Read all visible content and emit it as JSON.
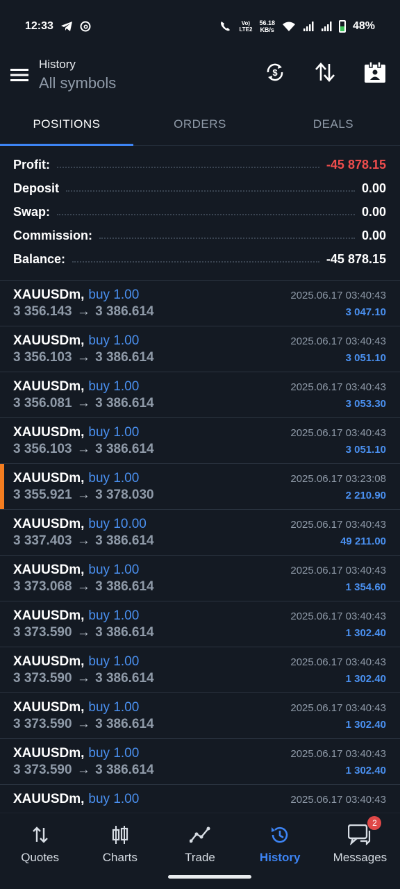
{
  "status_bar": {
    "time": "12:33",
    "net_speed_top": "56.18",
    "net_speed_bottom": "KB/s",
    "volte_top": "Vo)",
    "volte_bottom": "LTE2",
    "battery": "48%",
    "icons": [
      "telegram-icon",
      "threads-icon",
      "wifi-call-icon",
      "wifi-icon",
      "signal-icon",
      "battery-icon"
    ]
  },
  "header": {
    "small_title": "History",
    "big_title": "All symbols",
    "actions": [
      "currency-switch-icon",
      "sort-icon",
      "calendar-icon"
    ]
  },
  "tabs": [
    {
      "label": "POSITIONS",
      "active": true
    },
    {
      "label": "ORDERS",
      "active": false
    },
    {
      "label": "DEALS",
      "active": false
    }
  ],
  "summary": {
    "profit_label": "Profit:",
    "profit_value": "-45 878.15",
    "deposit_label": "Deposit",
    "deposit_value": "0.00",
    "swap_label": "Swap:",
    "swap_value": "0.00",
    "commission_label": "Commission:",
    "commission_value": "0.00",
    "balance_label": "Balance:",
    "balance_value": "-45 878.15"
  },
  "positions": [
    {
      "symbol": "XAUUSDm,",
      "side": "buy 1.00",
      "open": "3 356.143",
      "close": "3 386.614",
      "time": "2025.06.17 03:40:43",
      "profit": "3 047.10"
    },
    {
      "symbol": "XAUUSDm,",
      "side": "buy 1.00",
      "open": "3 356.103",
      "close": "3 386.614",
      "time": "2025.06.17 03:40:43",
      "profit": "3 051.10"
    },
    {
      "symbol": "XAUUSDm,",
      "side": "buy 1.00",
      "open": "3 356.081",
      "close": "3 386.614",
      "time": "2025.06.17 03:40:43",
      "profit": "3 053.30"
    },
    {
      "symbol": "XAUUSDm,",
      "side": "buy 1.00",
      "open": "3 356.103",
      "close": "3 386.614",
      "time": "2025.06.17 03:40:43",
      "profit": "3 051.10"
    },
    {
      "symbol": "XAUUSDm,",
      "side": "buy 1.00",
      "open": "3 355.921",
      "close": "3 378.030",
      "time": "2025.06.17 03:23:08",
      "profit": "2 210.90"
    },
    {
      "symbol": "XAUUSDm,",
      "side": "buy 10.00",
      "open": "3 337.403",
      "close": "3 386.614",
      "time": "2025.06.17 03:40:43",
      "profit": "49 211.00"
    },
    {
      "symbol": "XAUUSDm,",
      "side": "buy 1.00",
      "open": "3 373.068",
      "close": "3 386.614",
      "time": "2025.06.17 03:40:43",
      "profit": "1 354.60"
    },
    {
      "symbol": "XAUUSDm,",
      "side": "buy 1.00",
      "open": "3 373.590",
      "close": "3 386.614",
      "time": "2025.06.17 03:40:43",
      "profit": "1 302.40"
    },
    {
      "symbol": "XAUUSDm,",
      "side": "buy 1.00",
      "open": "3 373.590",
      "close": "3 386.614",
      "time": "2025.06.17 03:40:43",
      "profit": "1 302.40"
    },
    {
      "symbol": "XAUUSDm,",
      "side": "buy 1.00",
      "open": "3 373.590",
      "close": "3 386.614",
      "time": "2025.06.17 03:40:43",
      "profit": "1 302.40"
    },
    {
      "symbol": "XAUUSDm,",
      "side": "buy 1.00",
      "open": "3 373.590",
      "close": "3 386.614",
      "time": "2025.06.17 03:40:43",
      "profit": "1 302.40"
    },
    {
      "symbol": "XAUUSDm,",
      "side": "buy 1.00",
      "open": "",
      "close": "",
      "time": "2025.06.17 03:40:43",
      "profit": ""
    }
  ],
  "arrow": "→",
  "bottom_nav": [
    {
      "label": "Quotes",
      "icon": "quotes-icon"
    },
    {
      "label": "Charts",
      "icon": "charts-icon"
    },
    {
      "label": "Trade",
      "icon": "trade-icon"
    },
    {
      "label": "History",
      "icon": "history-icon",
      "active": true
    },
    {
      "label": "Messages",
      "icon": "messages-icon",
      "badge": "2"
    }
  ],
  "colors": {
    "background": "#141a23",
    "accent": "#3d84f4",
    "loss": "#ef4d4d",
    "marker": "#f47d20"
  }
}
